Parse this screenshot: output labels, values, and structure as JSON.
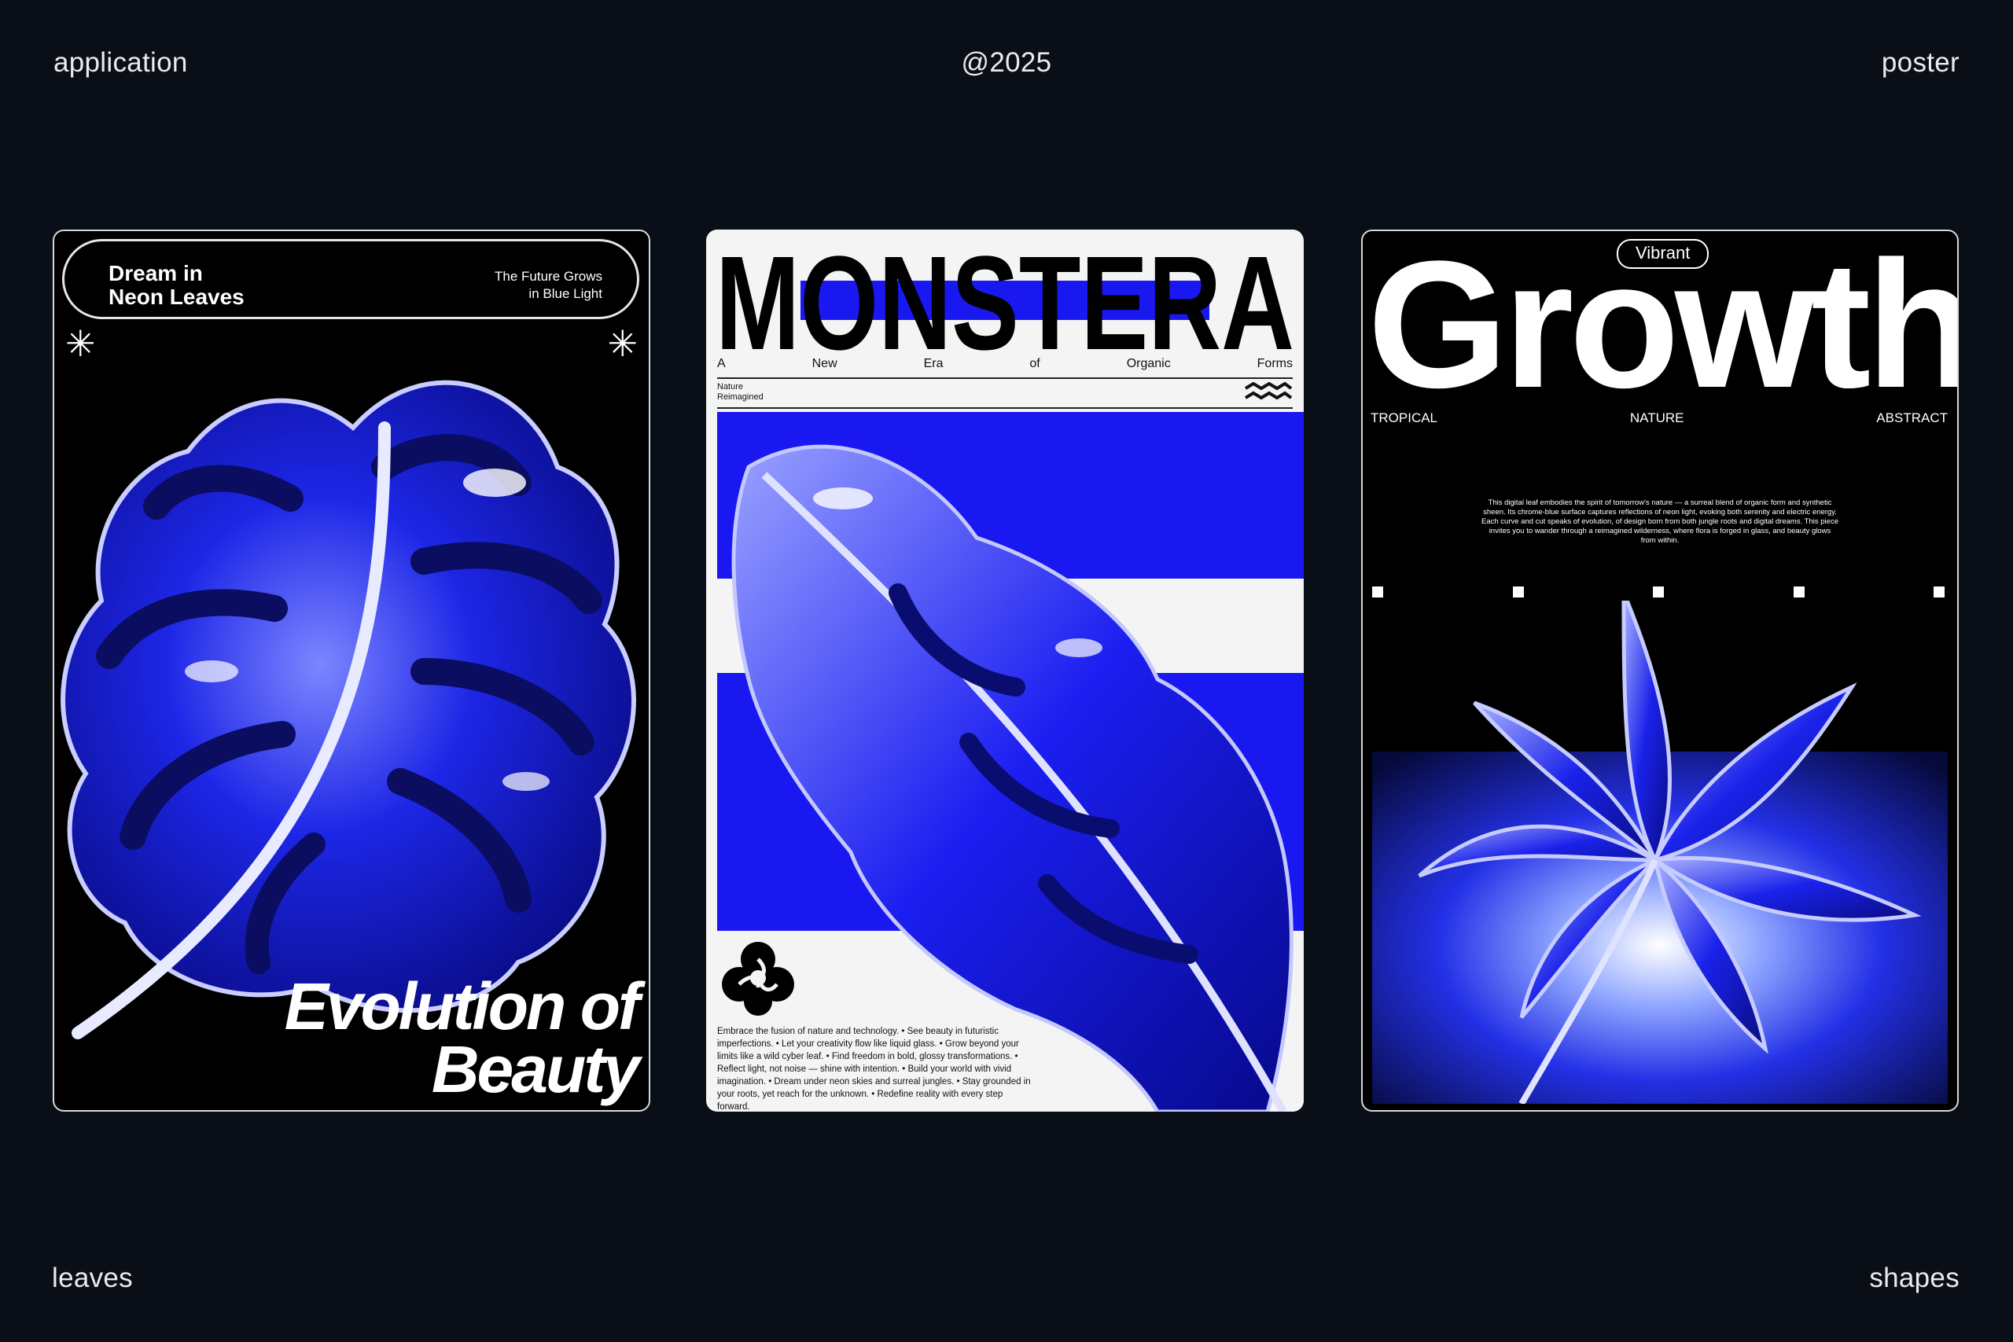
{
  "corners": {
    "top_left": "application",
    "top_center": "@2025",
    "top_right": "poster",
    "bottom_left": "leaves",
    "bottom_right": "shapes"
  },
  "poster1": {
    "title": "Dream in\nNeon Leaves",
    "subtitle": "The Future Grows\nin Blue Light",
    "headline_line1": "Evolution of",
    "headline_line2": "Beauty",
    "accent": "#1b22e8"
  },
  "poster2": {
    "title": "MONSTERA",
    "tagline": [
      "A",
      "New",
      "Era",
      "of",
      "Organic",
      "Forms"
    ],
    "note": "Nature\nReimagined",
    "body": "Embrace the fusion of nature and technology. • See beauty in futuristic imperfections. • Let your creativity flow like liquid glass. • Grow beyond your limits like a wild cyber leaf. • Find freedom in bold, glossy transformations. • Reflect light, not noise — shine with intention. • Build your world with vivid imagination. • Dream under neon skies and surreal jungles. • Stay grounded in your roots, yet reach for the unknown. • Redefine reality with every step forward.",
    "accent": "#1a18f0"
  },
  "poster3": {
    "badge": "Vibrant",
    "title": "Growth",
    "labels": [
      "TROPICAL",
      "NATURE",
      "ABSTRACT"
    ],
    "text": "This digital leaf embodies the spirit of tomorrow's nature — a surreal blend of organic form and synthetic sheen. Its chrome-blue surface captures reflections of neon light, evoking both serenity and electric energy. Each curve and cut speaks of evolution, of design born from both jungle roots and digital dreams. This piece invites you to wander through a reimagined wilderness, where flora is forged in glass, and beauty glows from within.",
    "accent": "#1a1fe6"
  }
}
